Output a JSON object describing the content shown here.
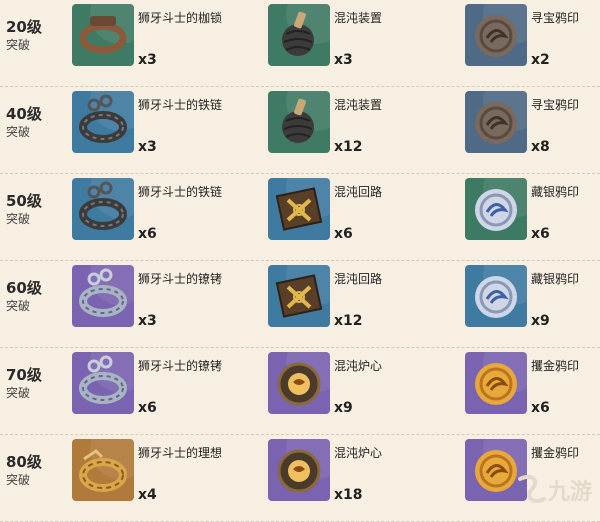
{
  "rows": [
    {
      "level": "20级",
      "breakthrough": "突破",
      "materials": [
        {
          "name": "狮牙斗士的枷锁",
          "count": "x3",
          "icon": "shackle-icon",
          "bg": "#3f7a64"
        },
        {
          "name": "混沌装置",
          "count": "x3",
          "icon": "chaos-device-icon",
          "bg": "#3f7a64"
        },
        {
          "name": "寻宝鸦印",
          "count": "x2",
          "icon": "crow-insignia-icon",
          "bg": "#4f6a86"
        }
      ]
    },
    {
      "level": "40级",
      "breakthrough": "突破",
      "materials": [
        {
          "name": "狮牙斗士的铁链",
          "count": "x3",
          "icon": "chain-icon",
          "bg": "#3f7aa0"
        },
        {
          "name": "混沌装置",
          "count": "x12",
          "icon": "chaos-device-icon",
          "bg": "#3f7a64"
        },
        {
          "name": "寻宝鸦印",
          "count": "x8",
          "icon": "crow-insignia-icon",
          "bg": "#4f6a86"
        }
      ]
    },
    {
      "level": "50级",
      "breakthrough": "突破",
      "materials": [
        {
          "name": "狮牙斗士的铁链",
          "count": "x6",
          "icon": "chain-icon",
          "bg": "#3f7aa0"
        },
        {
          "name": "混沌回路",
          "count": "x6",
          "icon": "chaos-circuit-icon",
          "bg": "#3f7aa0"
        },
        {
          "name": "藏银鸦印",
          "count": "x6",
          "icon": "silver-crow-insignia-icon",
          "bg": "#3d7a64"
        }
      ]
    },
    {
      "level": "60级",
      "breakthrough": "突破",
      "materials": [
        {
          "name": "狮牙斗士的镣铐",
          "count": "x3",
          "icon": "fetters-icon",
          "bg": "#7a63b0"
        },
        {
          "name": "混沌回路",
          "count": "x12",
          "icon": "chaos-circuit-icon",
          "bg": "#3f7aa0"
        },
        {
          "name": "藏银鸦印",
          "count": "x9",
          "icon": "silver-crow-insignia-icon",
          "bg": "#3f7aa0"
        }
      ]
    },
    {
      "level": "70级",
      "breakthrough": "突破",
      "materials": [
        {
          "name": "狮牙斗士的镣铐",
          "count": "x6",
          "icon": "fetters-icon",
          "bg": "#7a63b0"
        },
        {
          "name": "混沌炉心",
          "count": "x9",
          "icon": "chaos-core-icon",
          "bg": "#7a63b0"
        },
        {
          "name": "攫金鸦印",
          "count": "x6",
          "icon": "golden-crow-insignia-icon",
          "bg": "#7a63b0"
        }
      ]
    },
    {
      "level": "80级",
      "breakthrough": "突破",
      "materials": [
        {
          "name": "狮牙斗士的理想",
          "count": "x4",
          "icon": "ideal-icon",
          "bg": "#b07a3a"
        },
        {
          "name": "混沌炉心",
          "count": "x18",
          "icon": "chaos-core-icon",
          "bg": "#7a63b0"
        },
        {
          "name": "攫金鸦印",
          "count": "",
          "icon": "golden-crow-insignia-icon",
          "bg": "#7a63b0"
        }
      ]
    }
  ],
  "watermark": {
    "text": "九游",
    "icon": "jiuyou-logo-icon",
    "color": "#e8e0d0"
  }
}
